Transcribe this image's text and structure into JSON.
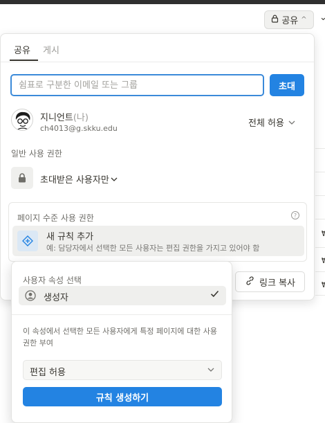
{
  "header": {
    "share_button_label": "공유",
    "share_icon": "lock-icon",
    "chevron_icon": "chevron-up-icon"
  },
  "tabs": [
    {
      "label": "공유",
      "active": true
    },
    {
      "label": "게시",
      "active": false
    }
  ],
  "invite": {
    "placeholder": "쉼표로 구분한 이메일 또는 그룹",
    "value": "",
    "button_label": "초대"
  },
  "member": {
    "name": "지니언트",
    "you_suffix": "(나)",
    "email": "ch4013@g.skku.edu",
    "permission": "전체 허용"
  },
  "general_access": {
    "label": "일반 사용 권한",
    "value": "초대받은 사용자만"
  },
  "page_level": {
    "title": "페이지 수준 사용 권한",
    "help_icon": "question-circle-icon",
    "add_rule_title": "새 규칙 추가",
    "add_rule_subtitle": "예: 담당자에서 선택한 모든 사용자는 편집 권한을 가지고 있어야 함"
  },
  "copy_link": {
    "label": "링크 복사",
    "icon": "link-icon"
  },
  "rule_dropdown": {
    "property_label": "사용자 속성 선택",
    "selected_property": "생성자",
    "description": "이 속성에서 선택한 모든 사용자에게 특정 페이지에 대한 사용 권한 부여",
    "permission_value": "편집 허용",
    "create_button": "규칙 생성하기"
  },
  "colors": {
    "accent": "#2383e2",
    "focus_border": "#3b8ad9"
  }
}
